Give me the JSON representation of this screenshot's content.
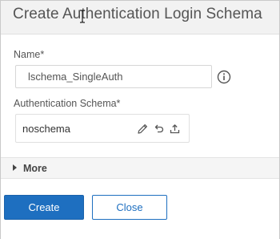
{
  "dialog": {
    "title": "Create Authentication Login Schema"
  },
  "form": {
    "name_label": "Name*",
    "name_value": "lschema_SingleAuth",
    "schema_label": "Authentication Schema*",
    "schema_value": "noschema"
  },
  "more": {
    "label": "More"
  },
  "footer": {
    "create_label": "Create",
    "close_label": "Close"
  },
  "colors": {
    "primary": "#1e6fc0",
    "header_bg": "#f2f2f2",
    "more_bg": "#f5f5f5"
  },
  "icons": [
    "text-cursor-icon",
    "info-icon",
    "edit-pencil-icon",
    "undo-icon",
    "upload-icon",
    "caret-right-icon"
  ]
}
